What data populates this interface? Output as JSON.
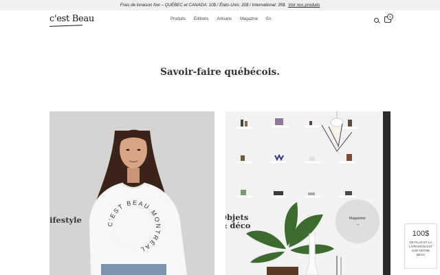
{
  "promo": {
    "text": "Frais de livraison fixe – QUÉBEC et CANADA: 10$ / États-Unis: 20$ / International: 35$.",
    "link": "Voir nos produits"
  },
  "header": {
    "logo": "c'est Beau",
    "nav": [
      "Produits",
      "Éditions",
      "Artisans",
      "Magazine",
      "En"
    ],
    "cart_count": "0"
  },
  "hero": {
    "headline": "Savoir-faire québécois."
  },
  "cards": [
    {
      "title": "Lifestyle",
      "sweatshirt_text": "C'EST BEAU MONTRÉAL"
    },
    {
      "title_line1": "Objets",
      "title_line2": "& déco"
    }
  ],
  "shop_button": {
    "label": "Magasiner",
    "arrow": "→"
  },
  "shipping_badge": {
    "amount": "100$",
    "text": "DE PLUS ET LA LIVRAISON EST SUR NOTRE BEAU"
  }
}
